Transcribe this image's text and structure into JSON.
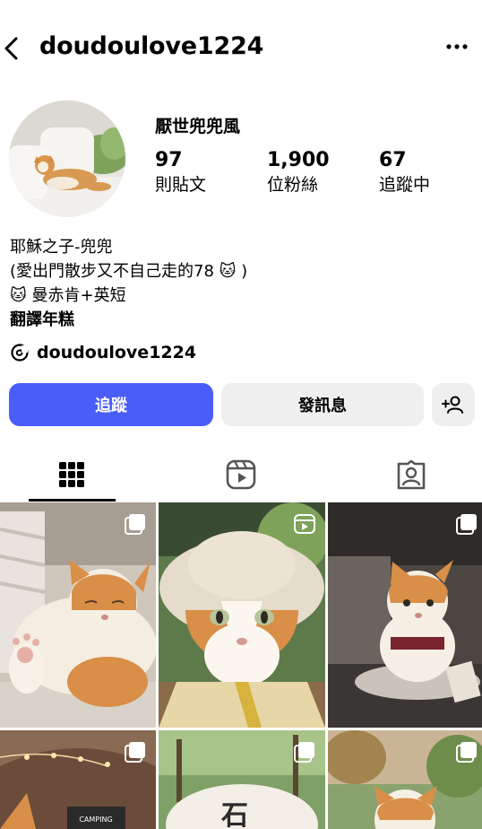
{
  "header": {
    "username": "doudoulove1224",
    "back_icon": "chevron-left-icon",
    "more_icon": "more-horizontal-icon"
  },
  "profile": {
    "display_name": "厭世兜兜風",
    "stats": [
      {
        "value": "97",
        "label": "則貼文"
      },
      {
        "value": "1,900",
        "label": "位粉絲"
      },
      {
        "value": "67",
        "label": "追蹤中"
      }
    ],
    "bio": [
      "耶穌之子-兜兜",
      "(愛出門散步又不自己走的78 🐱 )",
      "🐱 曼赤肯+英短",
      "翻譯年糕"
    ],
    "threads_handle": "doudoulove1224"
  },
  "buttons": {
    "follow": "追蹤",
    "message": "發訊息",
    "add_user_icon": "add-person-icon"
  },
  "tabs": [
    {
      "name": "posts",
      "icon": "grid-icon",
      "active": true
    },
    {
      "name": "reels",
      "icon": "reels-icon",
      "active": false
    },
    {
      "name": "tagged",
      "icon": "tagged-person-icon",
      "active": false
    }
  ],
  "posts": [
    {
      "type": "carousel",
      "subject": "cat-sleeping-on-sofa"
    },
    {
      "type": "reel",
      "subject": "cat-wearing-straw-hat"
    },
    {
      "type": "carousel",
      "subject": "cat-in-car-seat"
    },
    {
      "type": "carousel",
      "subject": "cat-camping-tent",
      "caption_text": "CAMPING"
    },
    {
      "type": "carousel",
      "subject": "cat-outdoor-sign"
    },
    {
      "type": "carousel",
      "subject": "cat-in-park"
    }
  ],
  "colors": {
    "accent": "#4a5df9",
    "secondary_button": "#efeff0"
  }
}
